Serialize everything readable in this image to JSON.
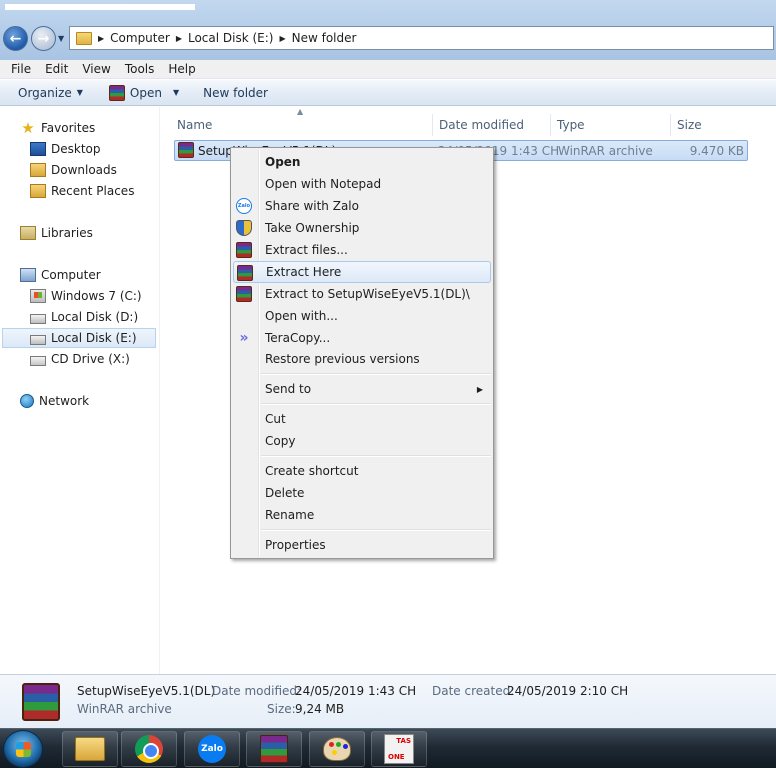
{
  "address": {
    "crumbs": [
      "Computer",
      "Local Disk (E:)",
      "New folder"
    ]
  },
  "menu": [
    "File",
    "Edit",
    "View",
    "Tools",
    "Help"
  ],
  "toolbar": {
    "organize": "Organize",
    "open": "Open",
    "new_folder": "New folder"
  },
  "nav": {
    "favorites": "Favorites",
    "desktop": "Desktop",
    "downloads": "Downloads",
    "recent": "Recent Places",
    "libraries": "Libraries",
    "computer": "Computer",
    "drive_c": "Windows 7 (C:)",
    "drive_d": "Local Disk (D:)",
    "drive_e": "Local Disk (E:)",
    "drive_x": "CD Drive (X:)",
    "network": "Network"
  },
  "columns": {
    "name": "Name",
    "date": "Date modified",
    "type": "Type",
    "size": "Size"
  },
  "file": {
    "name_visible": "SetupWiseEyeV5.1(DL)",
    "date": "24/05/2019 1:43 CH",
    "type": "WinRAR archive",
    "size": "9.470 KB"
  },
  "context_menu": {
    "open": "Open",
    "open_notepad": "Open with Notepad",
    "share_zalo": "Share with Zalo",
    "take_ownership": "Take Ownership",
    "extract_files": "Extract files...",
    "extract_here": "Extract Here",
    "extract_to": "Extract to SetupWiseEyeV5.1(DL)\\",
    "open_with": "Open with...",
    "teracopy": "TeraCopy...",
    "restore": "Restore previous versions",
    "send_to": "Send to",
    "cut": "Cut",
    "copy": "Copy",
    "create_shortcut": "Create shortcut",
    "delete": "Delete",
    "rename": "Rename",
    "properties": "Properties",
    "zalo_icon_text": "Zalo"
  },
  "details": {
    "name": "SetupWiseEyeV5.1(DL)",
    "type": "WinRAR archive",
    "date_modified_label": "Date modified:",
    "date_modified": "24/05/2019 1:43 CH",
    "date_created_label": "Date created:",
    "date_created": "24/05/2019 2:10 CH",
    "size_label": "Size:",
    "size": "9,24 MB"
  },
  "taskbar": {
    "zalo": "Zalo",
    "tas_top": "TAS",
    "tas_bottom": "ONE"
  }
}
